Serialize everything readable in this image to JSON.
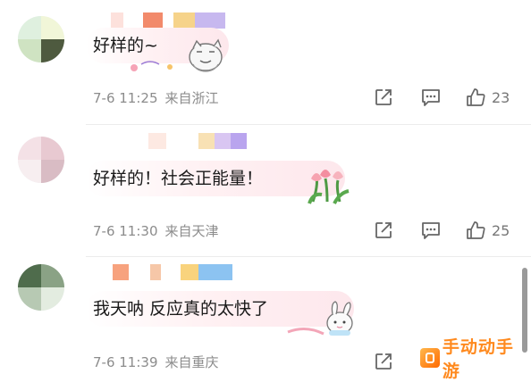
{
  "comments": [
    {
      "text": "好样的~",
      "date": "7-6 11:25",
      "location": "来自浙江",
      "likes": "23",
      "avatar_colors": [
        "#d7eed9",
        "#f3f7da",
        "#4e5a3f",
        "#c8ddb9"
      ],
      "name_colors": [
        "#fde1dc",
        "#f28a6b",
        "#f6d38a",
        "#c7b8ef"
      ]
    },
    {
      "text": "好样的！社会正能量！",
      "date": "7-6 11:30",
      "location": "来自天津",
      "likes": "25",
      "avatar_colors": [
        "#f4e1e6",
        "#e8c9d1",
        "#f7eef0",
        "#d9bcc4"
      ],
      "name_colors": [
        "#fde9e2",
        "#f8e1b4",
        "#d9c6f2",
        "#b9a4ee"
      ]
    },
    {
      "text": "我天呐 反应真的太快了",
      "date": "7-6 11:39",
      "location": "来自重庆",
      "likes": "",
      "avatar_colors": [
        "#4f6c4c",
        "#b7c9b3",
        "#e3ece0",
        "#8aa285"
      ],
      "name_colors": [
        "#f7a27e",
        "#f6c7a8",
        "#f9d37d",
        "#8cc3f1"
      ]
    }
  ],
  "icons": {
    "share": "share-icon",
    "comment": "comment-icon",
    "like": "thumbs-up-icon"
  },
  "watermark": {
    "text": "手动动手游"
  },
  "colors": {
    "meta_text": "#8c8c8c",
    "watermark": "#ff8a1f"
  }
}
